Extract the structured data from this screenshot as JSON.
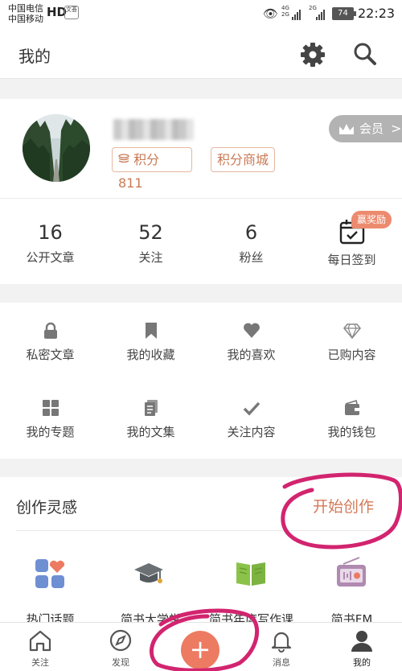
{
  "status_bar": {
    "carrier_1": "中国电信",
    "carrier_2": "中国移动",
    "hd_label": "HD",
    "badge_text": "文荟",
    "net_1": "4G",
    "net_2": "2G",
    "net_3": "2G",
    "battery": "74",
    "time": "22:23"
  },
  "header": {
    "title": "我的",
    "settings_icon": "gear-icon",
    "search_icon": "search-icon"
  },
  "profile": {
    "points_label": "积分 811",
    "points_mall": "积分商城",
    "member_label": "会员",
    "member_chevron": ">"
  },
  "stats": [
    {
      "value": "16",
      "label": "公开文章"
    },
    {
      "value": "52",
      "label": "关注"
    },
    {
      "value": "6",
      "label": "粉丝"
    },
    {
      "value": "",
      "label": "每日签到"
    }
  ],
  "reward_badge": "赢奖励",
  "menu": [
    {
      "label": "私密文章",
      "icon": "lock-icon"
    },
    {
      "label": "我的收藏",
      "icon": "bookmark-icon"
    },
    {
      "label": "我的喜欢",
      "icon": "heart-icon"
    },
    {
      "label": "已购内容",
      "icon": "diamond-icon"
    },
    {
      "label": "我的专题",
      "icon": "grid-icon"
    },
    {
      "label": "我的文集",
      "icon": "document-icon"
    },
    {
      "label": "关注内容",
      "icon": "check-icon"
    },
    {
      "label": "我的钱包",
      "icon": "wallet-icon"
    }
  ],
  "inspiration": {
    "title": "创作灵感",
    "start_label": "开始创作",
    "items": [
      {
        "label": "热门话题",
        "icon": "topics-icon"
      },
      {
        "label": "简书大学堂",
        "icon": "graduation-cap-icon"
      },
      {
        "label": "简书年度写作课",
        "icon": "open-book-icon"
      },
      {
        "label": "简书FM",
        "icon": "radio-icon"
      }
    ]
  },
  "tabbar": {
    "follow": "关注",
    "discover": "发现",
    "add": "+",
    "messages": "消息",
    "mine": "我的"
  },
  "colors": {
    "accent": "#ec7b62",
    "tag_text": "#c97a55",
    "annotation": "#d2246f"
  }
}
